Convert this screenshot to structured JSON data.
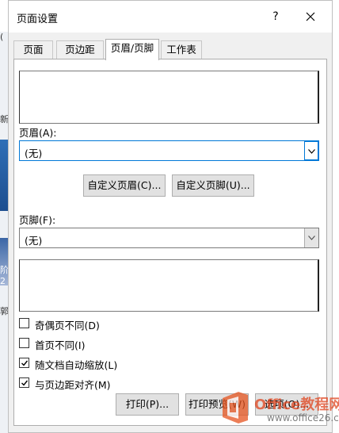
{
  "window": {
    "title": "页面设置",
    "help": "?"
  },
  "tabs": [
    {
      "label": "页面"
    },
    {
      "label": "页边距"
    },
    {
      "label": "页眉/页脚"
    },
    {
      "label": "工作表"
    }
  ],
  "header": {
    "label": "页眉(A):",
    "value": "(无)"
  },
  "custom_buttons": {
    "header": "自定义页眉(C)...",
    "footer": "自定义页脚(U)..."
  },
  "footer": {
    "label": "页脚(F):",
    "value": "(无)"
  },
  "options": [
    {
      "label": "奇偶页不同(D)",
      "checked": false
    },
    {
      "label": "首页不同(I)",
      "checked": false
    },
    {
      "label": "随文档自动缩放(L)",
      "checked": true
    },
    {
      "label": "与页边距对齐(M)",
      "checked": true
    }
  ],
  "bottom_buttons": {
    "print": "打印(P)...",
    "preview": "打印预览(W)",
    "options": "选项(O)..."
  },
  "watermark": {
    "text": "Office教程网",
    "url": "www.office26.com"
  },
  "background": {
    "fragments": [
      "(",
      "新",
      "阶",
      "2",
      "郭"
    ]
  }
}
